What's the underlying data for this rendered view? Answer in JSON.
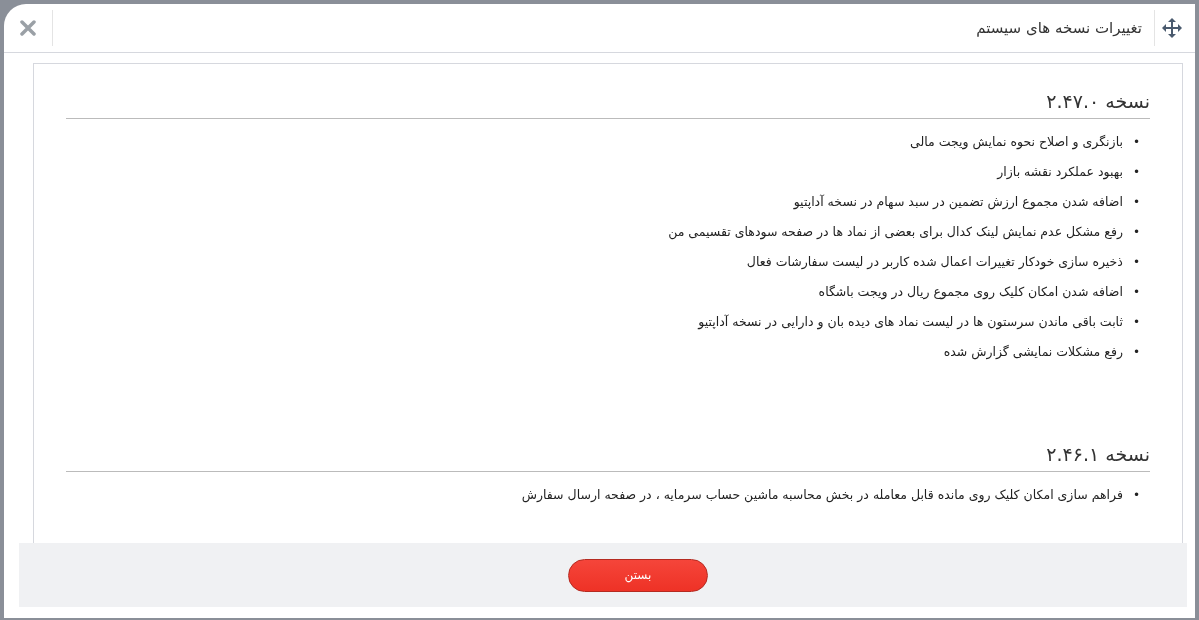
{
  "dialog": {
    "title": "تغییرات نسخه های سیستم"
  },
  "versions": [
    {
      "title": "نسخه ۲.۴۷.۰",
      "marker": "•",
      "items": [
        "بازنگری و اصلاح نحوه نمایش ویجت مالی",
        "بهبود عملکرد نقشه بازار",
        "اضافه شدن مجموع ارزش تضمین در سبد سهام در نسخه آداپتیو",
        "رفع مشکل عدم نمایش لینک کدال برای بعضی از نماد ها در صفحه سودهای تقسیمی من",
        "ذخیره سازی خودکار تغییرات اعمال شده کاربر در لیست سفارشات فعال",
        "اضافه شدن امکان کلیک روی مجموع ریال در ویجت باشگاه",
        "ثابت باقی ماندن سرستون ها در لیست نماد های دیده بان و دارایی در نسخه آداپتیو",
        "رفع مشکلات نمایشی گزارش شده"
      ]
    },
    {
      "title": "نسخه ۲.۴۶.۱",
      "marker": "•",
      "items": [
        "فراهم سازی امکان کلیک روی مانده قابل معامله در بخش محاسبه ماشین حساب سرمایه ، در صفحه ارسال سفارش"
      ]
    }
  ],
  "footer": {
    "close_button": "بستن"
  }
}
